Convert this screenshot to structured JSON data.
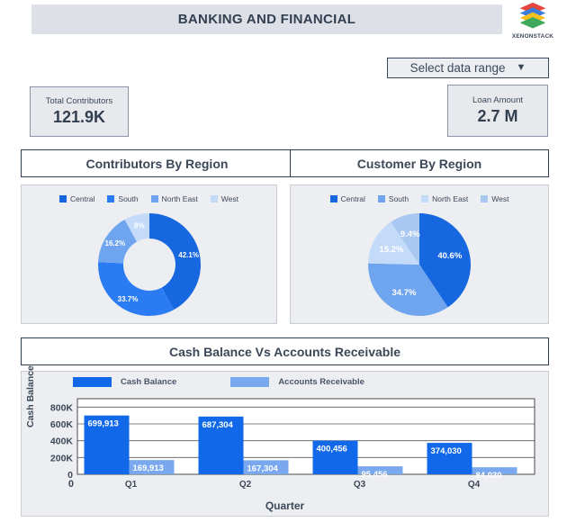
{
  "header": {
    "title": "BANKING AND FINANCIAL",
    "logo_text": "XENONSTACK",
    "logo_icon": "stacked-layers-icon"
  },
  "controls": {
    "date_range_label": "Select data range",
    "date_range_caret": "▼"
  },
  "kpis": [
    {
      "label": "Total Contributors",
      "value": "121.9K"
    },
    {
      "label": "Loan Amount",
      "value": "2.7 M"
    }
  ],
  "panels": {
    "contributors_title": "Contributors By Region",
    "customers_title": "Customer By Region",
    "cash_title": "Cash Balance Vs Accounts Receivable"
  },
  "colors": {
    "blue_dark": "#1667e0",
    "blue_mid": "#2b7bf3",
    "blue_light": "#6fa5ee",
    "blue_pale": "#c3daf8",
    "bar_dark": "#1168e8",
    "bar_light": "#7aa8ef",
    "panel_bg": "#eceef1",
    "header_bg": "#dde1e7",
    "text": "#3c4858"
  },
  "chart_data": [
    {
      "type": "pie",
      "title": "Contributors By Region",
      "variant": "donut",
      "legend_position": "top",
      "labels": [
        "Central",
        "South",
        "North East",
        "West"
      ],
      "values": [
        42.1,
        33.7,
        16.2,
        8.0
      ],
      "value_labels": [
        "42.1%",
        "33.7%",
        "16.2%",
        "8%"
      ],
      "colors": [
        "#1667e0",
        "#2b7bf3",
        "#6fa5ee",
        "#c3daf8"
      ]
    },
    {
      "type": "pie",
      "title": "Customer By Region",
      "variant": "pie",
      "legend_position": "top",
      "labels": [
        "Central",
        "South",
        "North East",
        "West"
      ],
      "values": [
        40.6,
        34.7,
        15.2,
        9.4
      ],
      "value_labels": [
        "40.6%",
        "34.7%",
        "15.2%",
        "9.4%"
      ],
      "colors": [
        "#1667e0",
        "#6fa5ee",
        "#c3daf8",
        "#a8c8f2"
      ]
    },
    {
      "type": "bar",
      "title": "Cash Balance Vs Accounts Receivable",
      "xlabel": "Quarter",
      "ylabel": "Cash Balance",
      "categories": [
        "Q1",
        "Q2",
        "Q3",
        "Q4"
      ],
      "ylim": [
        0,
        900000
      ],
      "yticks": [
        0,
        200000,
        400000,
        600000,
        800000
      ],
      "ytick_labels": [
        "0",
        "200K",
        "400K",
        "600K",
        "800K"
      ],
      "grid": true,
      "legend_position": "top",
      "series": [
        {
          "name": "Cash Balance",
          "color": "#1168e8",
          "values": [
            699913,
            687304,
            400456,
            374030
          ],
          "value_labels": [
            "699,913",
            "687,304",
            "400,456",
            "374,030"
          ]
        },
        {
          "name": "Accounts Receivable",
          "color": "#7aa8ef",
          "values": [
            169913,
            167304,
            95456,
            84030
          ],
          "value_labels": [
            "169,913",
            "167,304",
            "95,456",
            "84,030"
          ]
        }
      ]
    }
  ]
}
